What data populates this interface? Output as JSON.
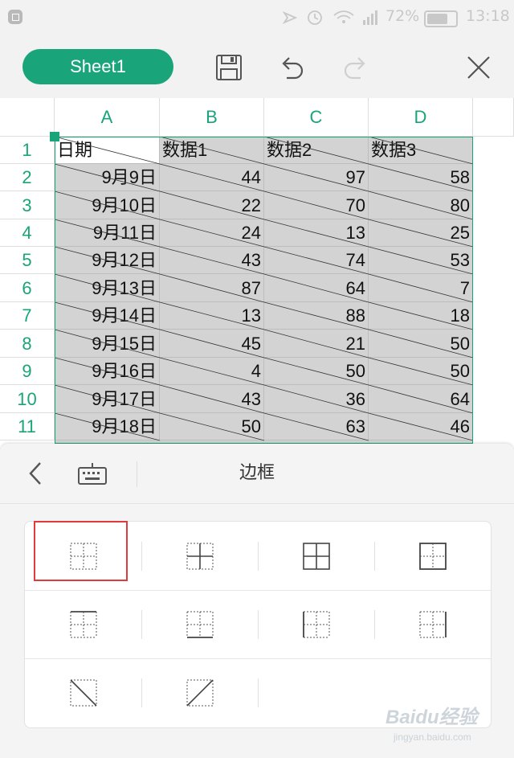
{
  "status_bar": {
    "battery": "72%",
    "time": "13:18"
  },
  "toolbar": {
    "sheet_tab": "Sheet1",
    "icons": [
      "save-icon",
      "undo-icon",
      "redo-icon",
      "close-icon"
    ]
  },
  "sheet": {
    "columns": [
      "A",
      "B",
      "C",
      "D"
    ],
    "rows": [
      "1",
      "2",
      "3",
      "4",
      "5",
      "6",
      "7",
      "8",
      "9",
      "10",
      "11"
    ],
    "header": [
      "日期",
      "数据1",
      "数据2",
      "数据3"
    ],
    "data": [
      [
        "9月9日",
        "44",
        "97",
        "58"
      ],
      [
        "9月10日",
        "22",
        "70",
        "80"
      ],
      [
        "9月11日",
        "24",
        "13",
        "25"
      ],
      [
        "9月12日",
        "43",
        "74",
        "53"
      ],
      [
        "9月13日",
        "87",
        "64",
        "7"
      ],
      [
        "9月14日",
        "13",
        "88",
        "18"
      ],
      [
        "9月15日",
        "45",
        "21",
        "50"
      ],
      [
        "9月16日",
        "4",
        "50",
        "50"
      ],
      [
        "9月17日",
        "43",
        "36",
        "64"
      ],
      [
        "9月18日",
        "50",
        "63",
        "46"
      ]
    ]
  },
  "border_panel": {
    "title": "边框",
    "icons": [
      "back-icon",
      "keyboard-icon"
    ],
    "options": [
      "border-none-icon",
      "border-inside-icon",
      "border-all-icon",
      "border-outside-icon",
      "border-top-icon",
      "border-bottom-icon",
      "border-left-icon",
      "border-right-icon",
      "border-diagonal-down-icon",
      "border-diagonal-up-icon"
    ]
  },
  "watermark": {
    "brand": "Baidu经验",
    "url": "jingyan.baidu.com"
  },
  "colors": {
    "accent": "#1aa47a",
    "selection_fill": "#d3d3d3",
    "highlight": "#e03a3a"
  }
}
